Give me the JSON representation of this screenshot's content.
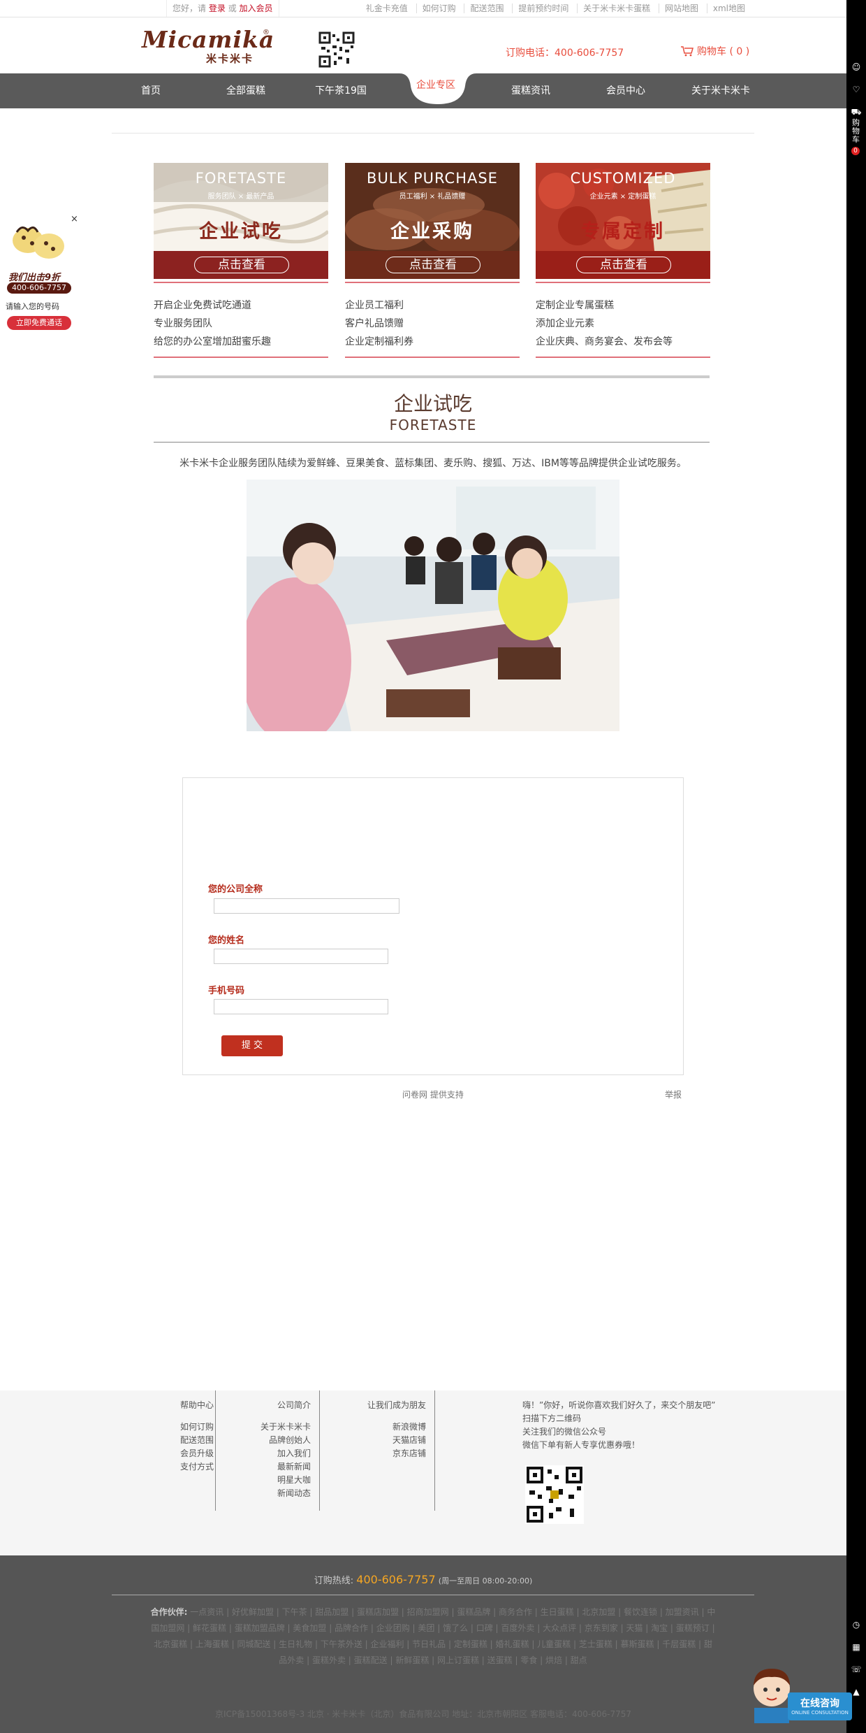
{
  "topbar": {
    "greeting_prefix": "您好，请",
    "login": "登录",
    "or": "或",
    "register": "加入会员",
    "links": [
      "礼金卡充值",
      "如何订购",
      "配送范围",
      "提前预约时间",
      "关于米卡米卡蛋糕",
      "网站地图",
      "xml地图"
    ]
  },
  "header": {
    "logo_en": "Micamika",
    "logo_cn": "米卡米卡",
    "logo_reg": "®",
    "hotline": "订购电话：400-606-7757",
    "cart": "购物车 ( 0 )"
  },
  "nav": {
    "items": [
      "首页",
      "全部蛋糕",
      "下午茶19国",
      "企业专区",
      "蛋糕资讯",
      "会员中心",
      "关于米卡米卡"
    ],
    "active_index": 3
  },
  "cards": [
    {
      "en": "FORETASTE",
      "sub": "服务团队 × 最新产品",
      "big": "企业试吃",
      "btn": "点击查看",
      "big_color": "#8c2a1e",
      "list": [
        "开启企业免费试吃通道",
        "专业服务团队",
        "给您的办公室增加甜蜜乐趣"
      ]
    },
    {
      "en": "BULK PURCHASE",
      "sub": "员工福利 × 礼品馈赠",
      "big": "企业采购",
      "btn": "点击查看",
      "big_color": "#ffffff",
      "list": [
        "企业员工福利",
        "客户礼品馈赠",
        "企业定制福利券"
      ]
    },
    {
      "en": "CUSTOMIZED",
      "sub": "企业元素 × 定制蛋糕",
      "big": "专属定制",
      "btn": "点击查看",
      "big_color": "#b5201a",
      "list": [
        "定制企业专属蛋糕",
        "添加企业元素",
        "企业庆典、商务宴会、发布会等"
      ]
    }
  ],
  "section": {
    "title_cn": "企业试吃",
    "title_en": "FORETASTE",
    "intro": "米卡米卡企业服务团队陆续为爱鲜蜂、豆果美食、蓝标集团、麦乐购、搜狐、万达、IBM等等品牌提供企业试吃服务。"
  },
  "form": {
    "company_label": "您的公司全称",
    "name_label": "您的姓名",
    "phone_label": "手机号码",
    "submit": "提 交"
  },
  "support": {
    "provider": "问卷网",
    "support_text": "提供支持",
    "report": "举报"
  },
  "footer": {
    "col1": {
      "title": "帮助中心",
      "items": [
        "如何订购",
        "配送范围",
        "会员升级",
        "支付方式"
      ]
    },
    "col2": {
      "title": "公司简介",
      "items": [
        "关于米卡米卡",
        "品牌创始人",
        "加入我们",
        "最新新闻",
        "明星大咖",
        "新闻动态"
      ]
    },
    "col3": {
      "title": "让我们成为朋友",
      "items": [
        "新浪微博",
        "天猫店铺",
        "京东店铺"
      ]
    },
    "wechat": [
      "嗨！”你好，听说你喜欢我们好久了，来交个朋友吧”",
      "扫描下方二维码",
      "关注我们的微信公众号",
      "微信下单有新人专享优惠券哦！"
    ],
    "hotline_label": "订购热线:",
    "hotline_num": "400-606-7757",
    "hotline_hours": "(周一至周日 08:00-20:00)",
    "partners_label": "合作伙伴:",
    "partners": "一点资讯 | 好优鲜加盟 | 下午茶 | 甜品加盟 | 蛋糕店加盟 | 招商加盟网 | 蛋糕品牌 | 商务合作 | 生日蛋糕 | 北京加盟 | 餐饮连锁 | 加盟资讯 | 中国加盟网 | 鲜花蛋糕 | 蛋糕加盟品牌 | 美食加盟 | 品牌合作 | 企业团购 | 美团 | 饿了么 | 口碑 | 百度外卖 | 大众点评 | 京东到家 | 天猫 | 淘宝 | 蛋糕预订 | 北京蛋糕 | 上海蛋糕 | 同城配送 | 生日礼物 | 下午茶外送 | 企业福利 | 节日礼品 | 定制蛋糕 | 婚礼蛋糕 | 儿童蛋糕 | 芝士蛋糕 | 慕斯蛋糕 | 千层蛋糕 | 甜品外卖 | 蛋糕外卖 | 蛋糕配送 | 新鲜蛋糕 | 网上订蛋糕 | 送蛋糕 | 零食 | 烘焙 | 甜点",
    "copyright": "京ICP备15001368号-3 北京 · 米卡米卡（北京）食品有限公司 地址：北京市朝阳区 客服电话：400-606-7757"
  },
  "promo": {
    "line1": "我们出击9折",
    "phone": "400-606-7757",
    "input_hint": "请输入您的号码",
    "btn": "立即免费通话",
    "close": "×"
  },
  "sidebar": {
    "cart_label": "购物车",
    "cart_count": "0"
  },
  "consult": {
    "label": "在线咨询",
    "sub": "ONLINE CONSULTATION"
  },
  "colors": {
    "brand_red": "#e84d3d",
    "nav_bg": "#5a5a5a",
    "submit_bg": "#c0301f",
    "footer_dark": "#555555"
  }
}
